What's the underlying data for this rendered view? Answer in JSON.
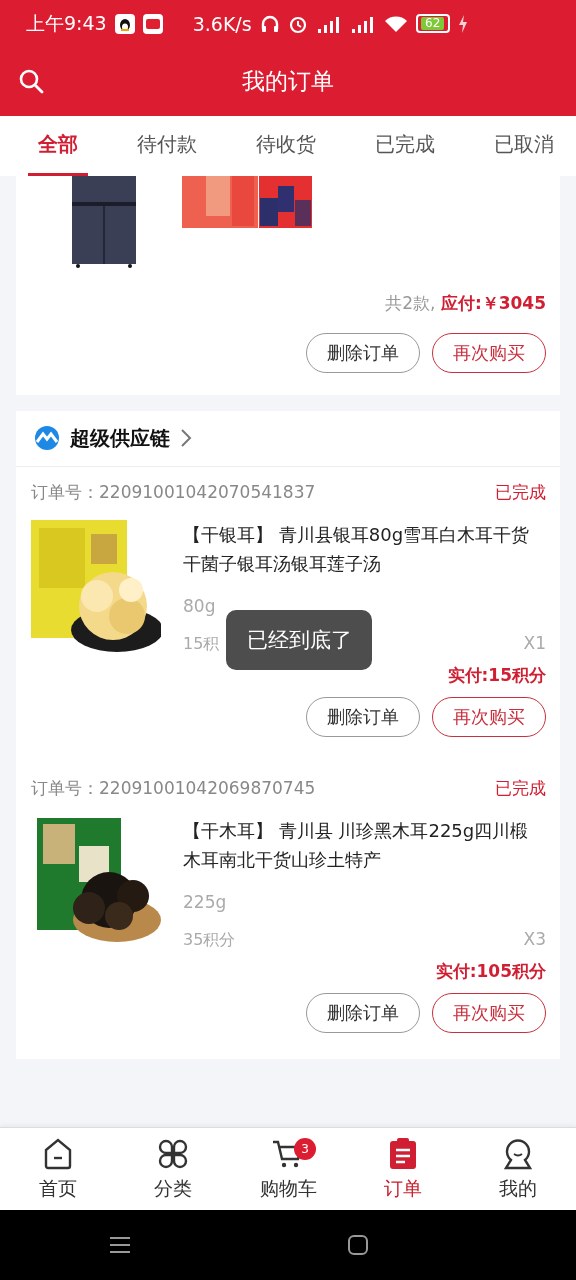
{
  "status_bar": {
    "time": "上午9:43",
    "speed": "3.6K/s",
    "battery": "62"
  },
  "header": {
    "title": "我的订单"
  },
  "tabs": [
    {
      "label": "全部",
      "selected": true
    },
    {
      "label": "待付款",
      "selected": false
    },
    {
      "label": "待收货",
      "selected": false
    },
    {
      "label": "已完成",
      "selected": false
    },
    {
      "label": "已取消",
      "selected": false
    }
  ],
  "partial_order": {
    "summary_count": "共2款,",
    "summary_total": "应付:￥3045",
    "buttons": [
      {
        "label": "删除订单",
        "kind": "secondary"
      },
      {
        "label": "再次购买",
        "kind": "primary"
      }
    ]
  },
  "store": {
    "name": "超级供应链",
    "orders": [
      {
        "order_no": "订单号：22091001042070541837",
        "status": "已完成",
        "kind": "silver",
        "title": "【干银耳】 青川县银耳80g雪耳白木耳干货干菌子银耳汤银耳莲子汤",
        "spec": "80g",
        "points": "15积",
        "quantity": "X1",
        "paid": "实付:15积分",
        "buttons": [
          {
            "label": "删除订单",
            "kind": "secondary"
          },
          {
            "label": "再次购买",
            "kind": "primary"
          }
        ]
      },
      {
        "order_no": "订单号：22091001042069870745",
        "status": "已完成",
        "kind": "black",
        "title": "【干木耳】 青川县 川珍黑木耳225g四川椴木耳南北干货山珍土特产",
        "spec": "225g",
        "points": "35积分",
        "quantity": "X3",
        "paid": "实付:105积分",
        "buttons": [
          {
            "label": "删除订单",
            "kind": "secondary"
          },
          {
            "label": "再次购买",
            "kind": "primary"
          }
        ]
      }
    ]
  },
  "toast": "已经到底了",
  "bottom_nav": [
    {
      "label": "首页",
      "kind": "home",
      "selected": false
    },
    {
      "label": "分类",
      "kind": "category",
      "selected": false
    },
    {
      "label": "购物车",
      "kind": "cart",
      "selected": false,
      "badge": "3"
    },
    {
      "label": "订单",
      "kind": "orders",
      "selected": true
    },
    {
      "label": "我的",
      "kind": "profile",
      "selected": false
    }
  ]
}
